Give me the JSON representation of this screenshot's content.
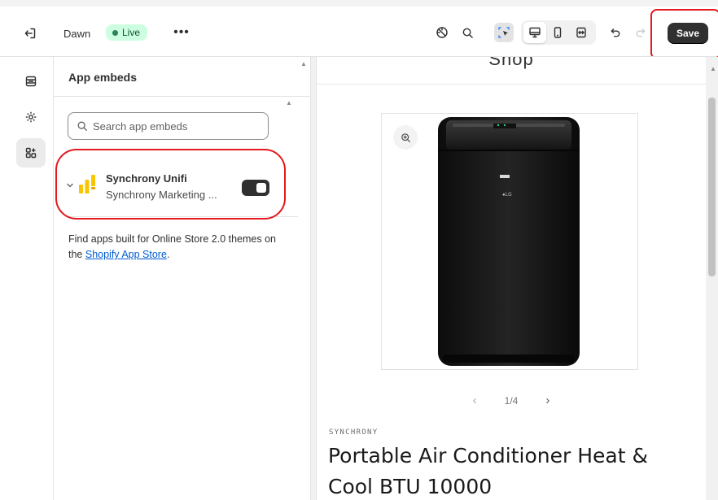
{
  "header": {
    "exit_icon": "exit-icon",
    "theme_name": "Dawn",
    "status_badge": "Live",
    "more_label": "•••",
    "tools": [
      {
        "name": "accessibility-icon"
      },
      {
        "name": "search-icon"
      },
      {
        "name": "inspector-icon",
        "selected": true
      },
      {
        "name": "desktop-icon",
        "selected": true
      },
      {
        "name": "mobile-icon"
      },
      {
        "name": "full-width-icon"
      },
      {
        "name": "undo-icon"
      },
      {
        "name": "redo-icon"
      }
    ],
    "save_label": "Save"
  },
  "sidebar": {
    "items": [
      {
        "name": "sections-icon"
      },
      {
        "name": "theme-settings-icon"
      },
      {
        "name": "app-embeds-icon",
        "active": true
      }
    ]
  },
  "panel": {
    "title": "App embeds",
    "search": {
      "placeholder": "Search app embeds",
      "value": ""
    },
    "embeds": [
      {
        "name": "Synchrony Unifi",
        "subtitle": "Synchrony Marketing ...",
        "enabled": true
      }
    ],
    "help_text_prefix": "Find apps built for Online Store 2.0 themes on the ",
    "help_link": "Shopify App Store",
    "help_text_suffix": "."
  },
  "preview": {
    "shop_title": "Shop",
    "carousel_position": "1/4",
    "vendor": "SYNCHRONY",
    "product_title": "Portable Air Conditioner Heat & Cool BTU 10000"
  },
  "colors": {
    "accent": "#303030",
    "live_badge_bg": "#cdfee1",
    "live_dot": "#29845a",
    "highlight_red": "#e4181e",
    "link": "#005bd3"
  }
}
